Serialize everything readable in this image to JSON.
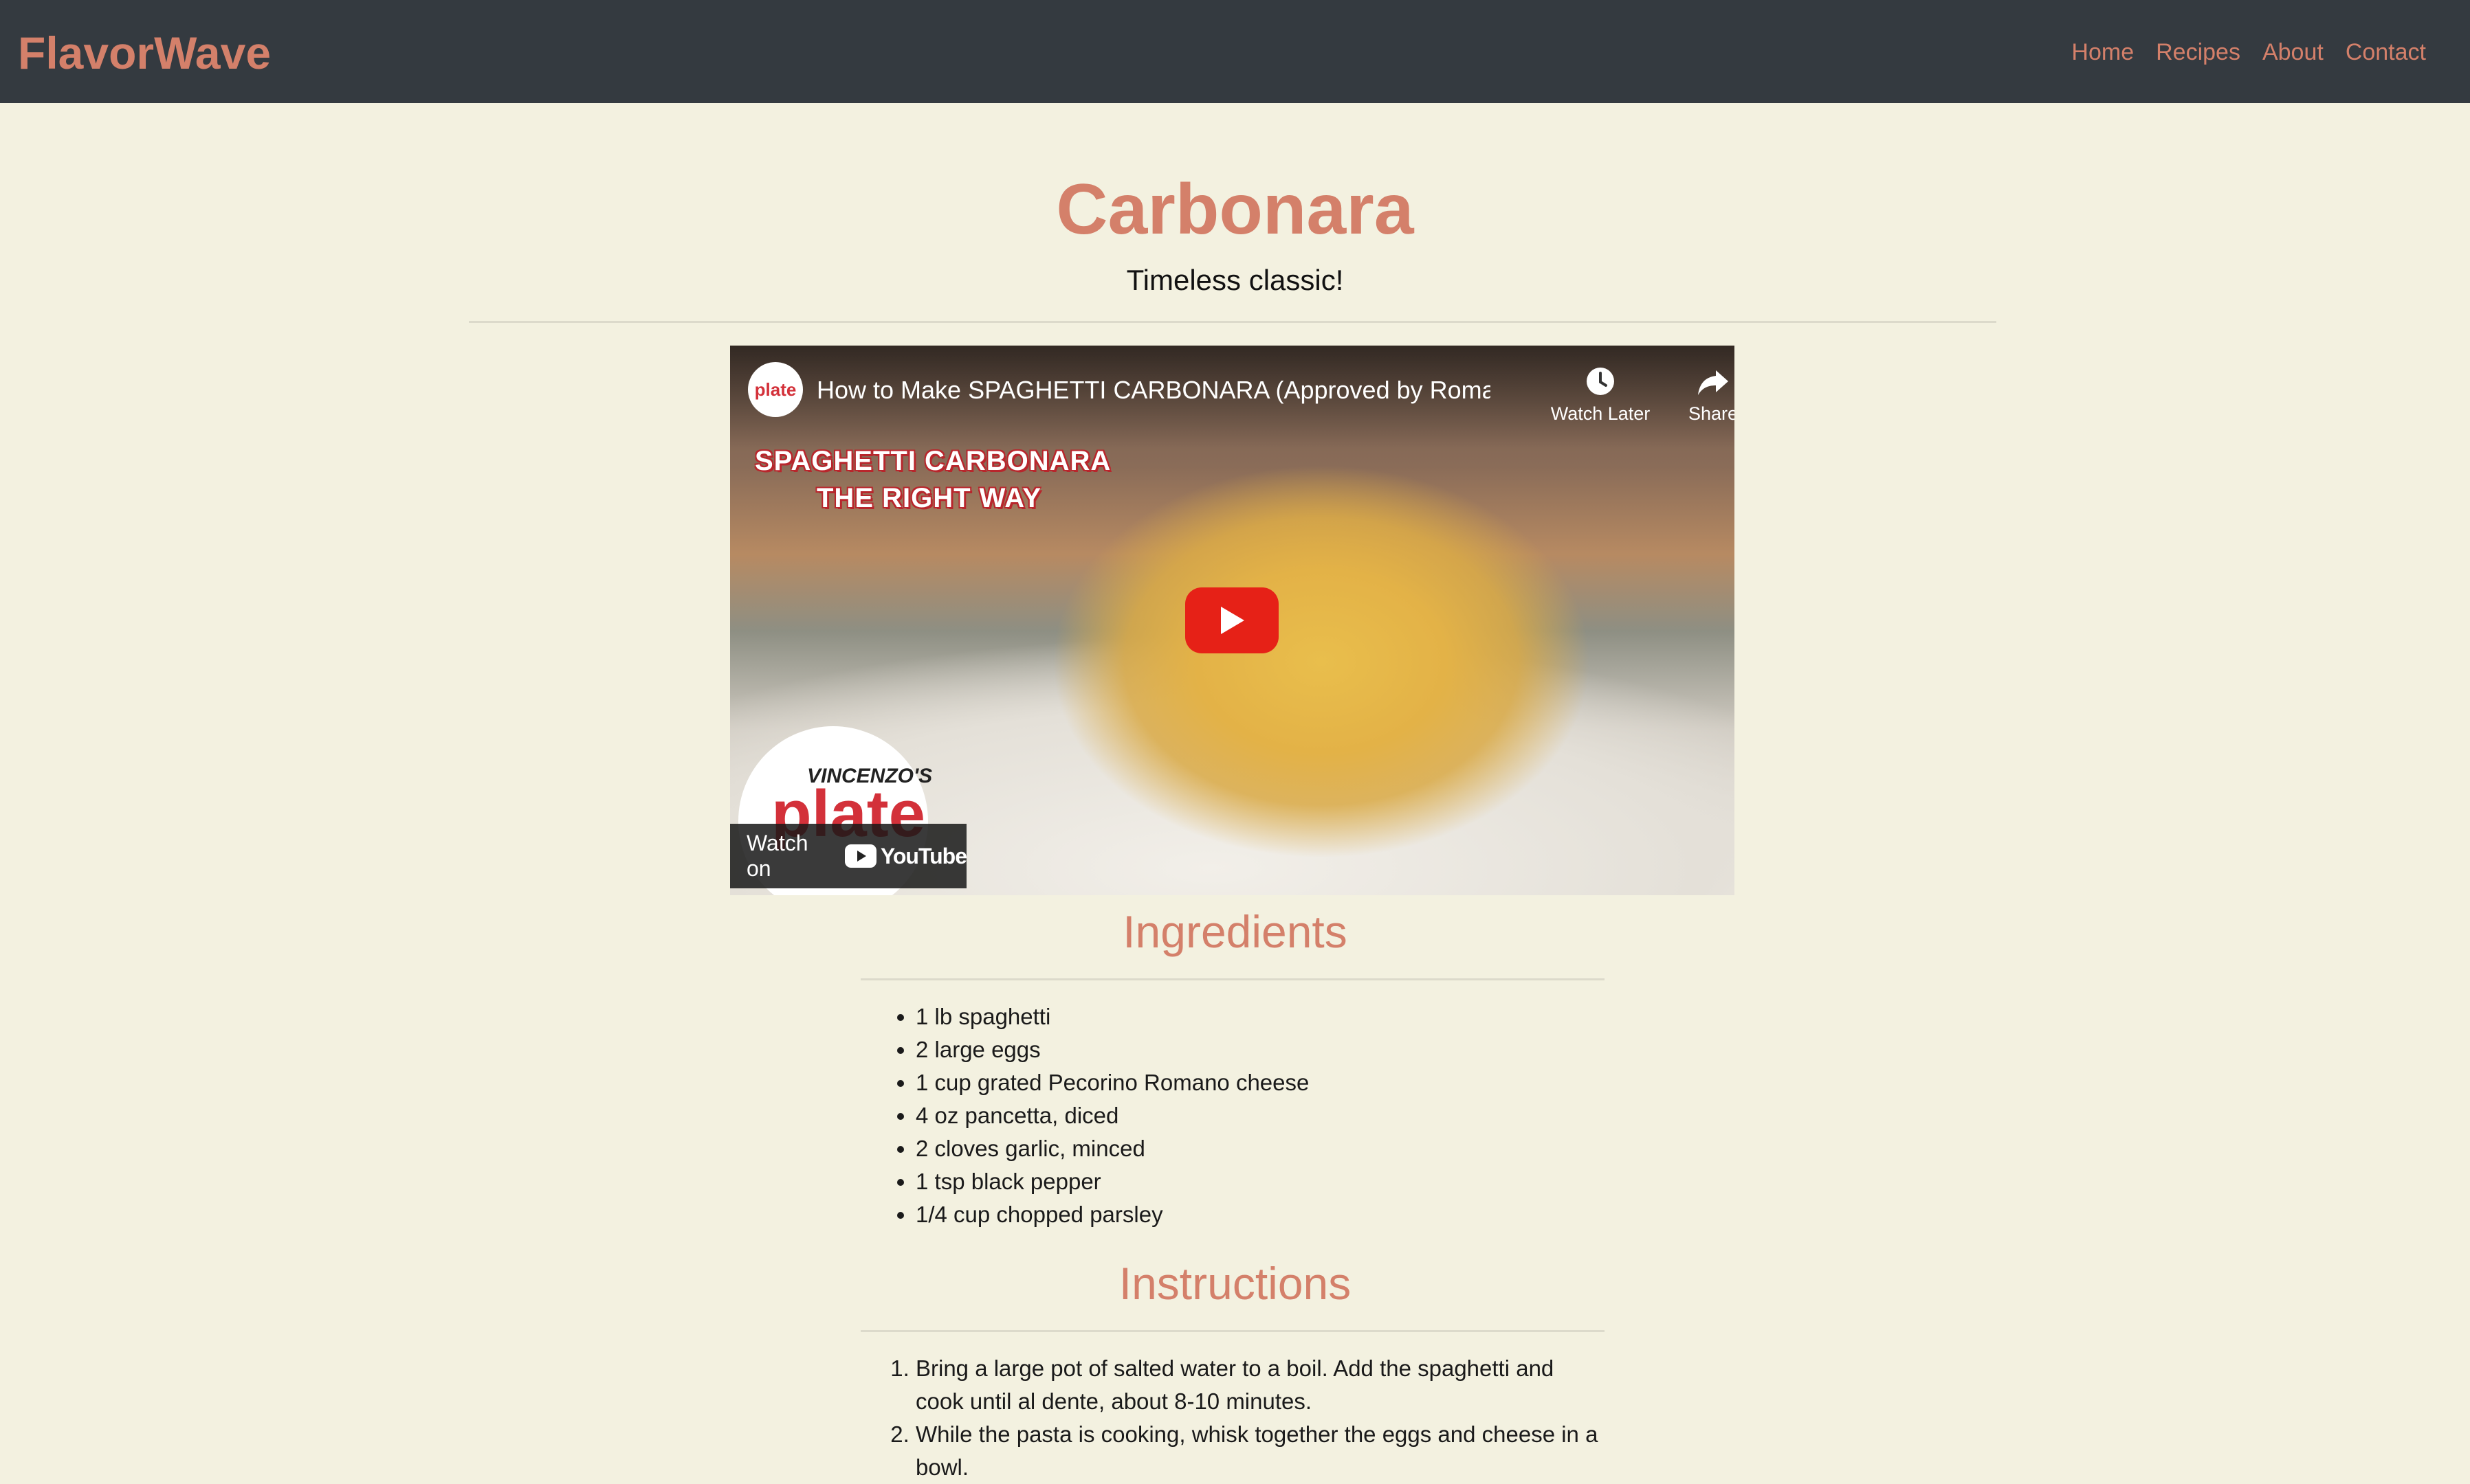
{
  "navbar": {
    "brand": "FlavorWave",
    "links": [
      "Home",
      "Recipes",
      "About",
      "Contact"
    ]
  },
  "recipe": {
    "title": "Carbonara",
    "subtitle": "Timeless classic!"
  },
  "video": {
    "title": "How to Make SPAGHETTI CARBONARA (Approved by Roma...",
    "channel_avatar_text": "plate",
    "watch_later_label": "Watch Later",
    "share_label": "Share",
    "overlay_line1": "SPAGHETTI CARBONARA",
    "overlay_line2": "THE RIGHT WAY",
    "logo_small": "VINCENZO'S",
    "logo_big": "plate",
    "watch_on_label": "Watch on",
    "youtube_label": "YouTube",
    "colors": {
      "play_button": "#e62117",
      "overlay_red": "#b8262c"
    }
  },
  "ingredients": {
    "heading": "Ingredients",
    "items": [
      "1 lb spaghetti",
      "2 large eggs",
      "1 cup grated Pecorino Romano cheese",
      "4 oz pancetta, diced",
      "2 cloves garlic, minced",
      "1 tsp black pepper",
      "1/4 cup chopped parsley"
    ]
  },
  "instructions": {
    "heading": "Instructions",
    "steps": [
      "Bring a large pot of salted water to a boil. Add the spaghetti and cook until al dente, about 8-10 minutes.",
      "While the pasta is cooking, whisk together the eggs and cheese in a bowl."
    ]
  },
  "colors": {
    "background": "#f3f1e0",
    "navbar": "#343a40",
    "accent": "#d4806a"
  }
}
